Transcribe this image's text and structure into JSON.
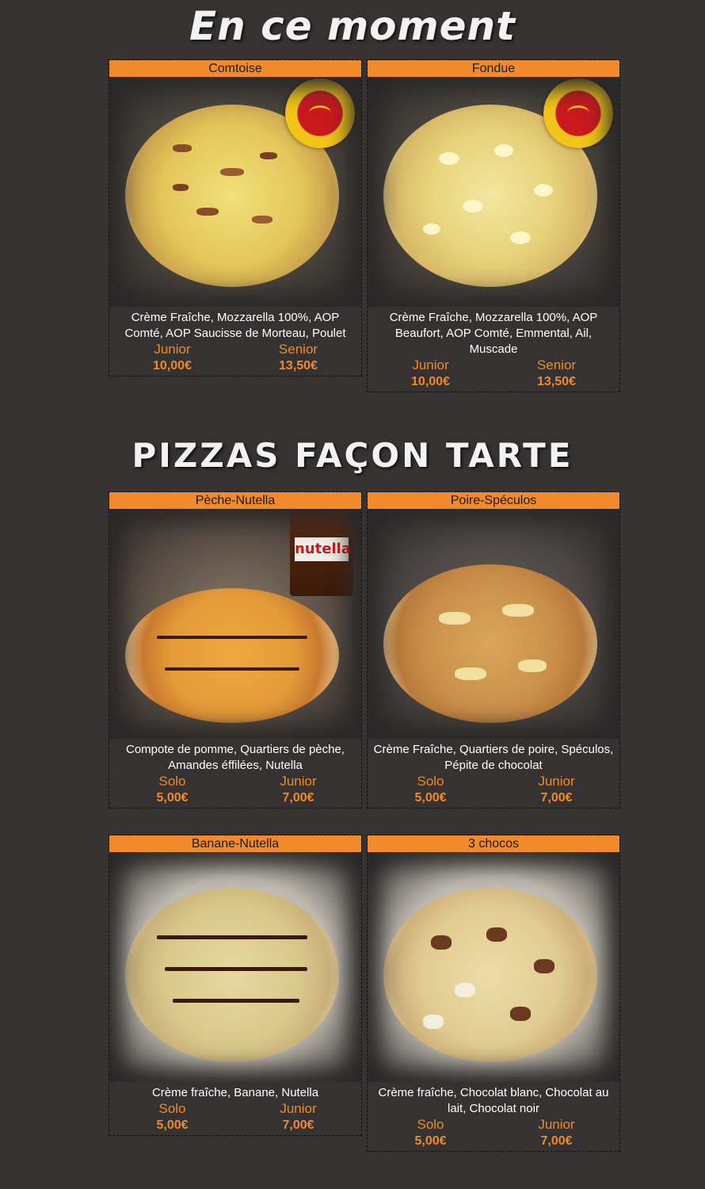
{
  "sections": [
    {
      "title": "En ce moment",
      "cards": [
        {
          "name": "Comtoise",
          "description": "Crème Fraîche, Mozzarella 100%, AOP Comté, AOP Saucisse de Morteau, Poulet",
          "prices": [
            {
              "size": "Junior",
              "amount": "10,00€"
            },
            {
              "size": "Senior",
              "amount": "13,50€"
            }
          ]
        },
        {
          "name": "Fondue",
          "description": "Crème Fraîche, Mozzarella 100%, AOP Beaufort, AOP Comté, Emmental, Ail, Muscade",
          "prices": [
            {
              "size": "Junior",
              "amount": "10,00€"
            },
            {
              "size": "Senior",
              "amount": "13,50€"
            }
          ]
        }
      ]
    },
    {
      "title": "PIZZAS FAÇON TARTE",
      "cards": [
        {
          "name": "Pèche-Nutella",
          "description": "Compote de pomme, Quartiers de pèche, Amandes éffilées, Nutella",
          "prices": [
            {
              "size": "Solo",
              "amount": "5,00€"
            },
            {
              "size": "Junior",
              "amount": "7,00€"
            }
          ]
        },
        {
          "name": "Poire-Spéculos",
          "description": "Crème Fraîche, Quartiers de poire, Spéculos, Pépite de chocolat",
          "prices": [
            {
              "size": "Solo",
              "amount": "5,00€"
            },
            {
              "size": "Junior",
              "amount": "7,00€"
            }
          ]
        },
        {
          "name": "Banane-Nutella",
          "description": "Crème fraîche, Banane, Nutella",
          "prices": [
            {
              "size": "Solo",
              "amount": "5,00€"
            },
            {
              "size": "Junior",
              "amount": "7,00€"
            }
          ]
        },
        {
          "name": "3 chocos",
          "description": "Crème fraîche, Chocolat blanc, Chocolat au lait, Chocolat noir",
          "prices": [
            {
              "size": "Solo",
              "amount": "5,00€"
            },
            {
              "size": "Junior",
              "amount": "7,00€"
            }
          ]
        }
      ]
    }
  ],
  "photos": {
    "jar_label": "nutella"
  },
  "colors": {
    "accent": "#f08a2b",
    "background": "#353231",
    "text": "#ffffff"
  }
}
